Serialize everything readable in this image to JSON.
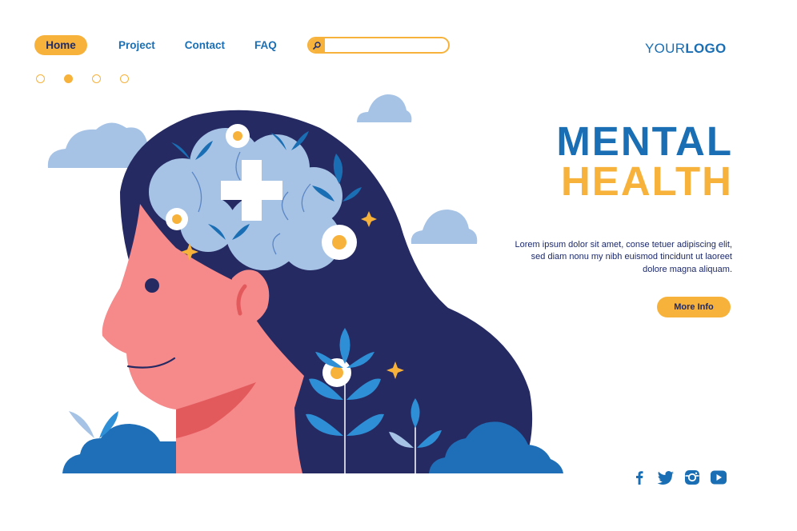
{
  "nav": {
    "items": [
      {
        "label": "Home"
      },
      {
        "label": "Project"
      },
      {
        "label": "Contact"
      },
      {
        "label": "FAQ"
      }
    ],
    "active_index": 0
  },
  "search": {
    "placeholder": "",
    "value": "",
    "icon": "search-icon"
  },
  "logo": {
    "part1": "YOUR",
    "part2": "LOGO"
  },
  "slider": {
    "dot_count": 4,
    "active_index": 1
  },
  "hero": {
    "title_line1": "MENTAL",
    "title_line2": "HEALTH",
    "paragraph": "Lorem ipsum dolor sit amet, conse tetuer adipiscing elit, sed diam nonu my nibh euismod tincidunt ut laoreet dolore magna aliquam.",
    "cta_label": "More Info"
  },
  "social": [
    "facebook-icon",
    "twitter-icon",
    "instagram-icon",
    "youtube-icon"
  ],
  "colors": {
    "accent": "#f7b23b",
    "primary_blue": "#1a6fb4",
    "navy": "#1d2a6b",
    "hair": "#262a63",
    "skin": "#f6898a",
    "brain": "#a6c3e6",
    "cloud": "#a6c3e6"
  }
}
